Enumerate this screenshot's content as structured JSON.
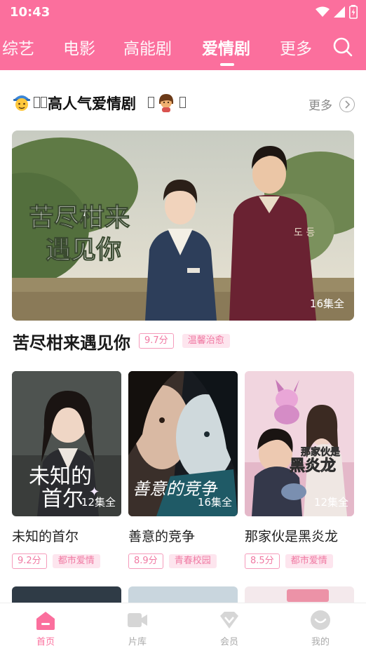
{
  "status": {
    "time": "10:43"
  },
  "tabs": [
    "综艺",
    "电影",
    "高能剧",
    "爱情剧",
    "更多"
  ],
  "active_tab": 3,
  "section": {
    "title": "高人气爱情剧",
    "more_label": "更多"
  },
  "hero": {
    "title": "苦尽柑来遇见你",
    "episodes": "16集全",
    "score": "9.7分",
    "genre": "温馨治愈",
    "poster_text_1": "苦尽柑来",
    "poster_text_2": "遇见你",
    "badge_text": "도 등"
  },
  "cards": [
    {
      "title": "未知的首尔",
      "episodes": "12集全",
      "score": "9.2分",
      "genre": "都市爱情",
      "poster_text": "未知的 首尔"
    },
    {
      "title": "善意的竞争",
      "episodes": "16集全",
      "score": "8.9分",
      "genre": "青春校园",
      "poster_text": "善意的竞争"
    },
    {
      "title": "那家伙是黑炎龙",
      "episodes": "12集全",
      "score": "8.5分",
      "genre": "都市爱情",
      "poster_text_1": "那家伙是",
      "poster_text_2": "黑炎龙"
    }
  ],
  "bottom_nav": [
    {
      "label": "首页",
      "icon": "home-icon"
    },
    {
      "label": "片库",
      "icon": "video-library-icon"
    },
    {
      "label": "会员",
      "icon": "vip-icon"
    },
    {
      "label": "我的",
      "icon": "profile-icon"
    }
  ],
  "colors": {
    "accent": "#fb6f9d",
    "tag_text": "#f07aa3",
    "tag_bg": "#fde5ee"
  }
}
